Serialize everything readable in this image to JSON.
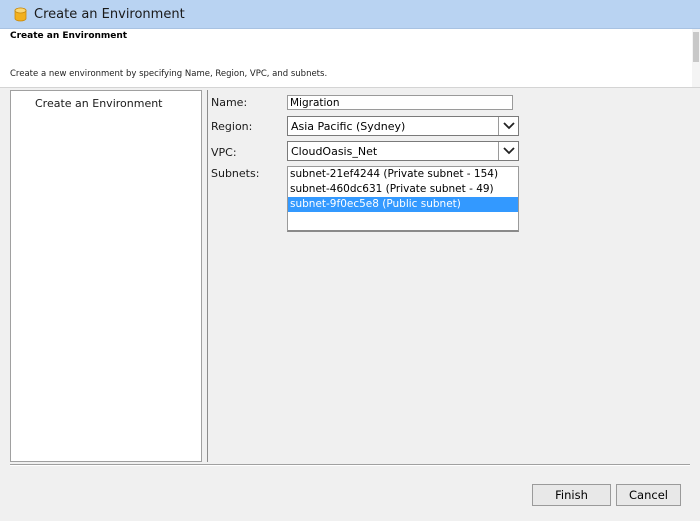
{
  "window": {
    "title": "Create an Environment"
  },
  "header": {
    "title": "Create an Environment",
    "description": "Create a new environment by specifying Name, Region, VPC, and subnets."
  },
  "nav": {
    "items": [
      {
        "label": "Create an Environment"
      }
    ]
  },
  "form": {
    "name_label": "Name:",
    "name_value": "Migration",
    "region_label": "Region:",
    "region_value": "Asia Pacific (Sydney)",
    "vpc_label": "VPC:",
    "vpc_value": "CloudOasis_Net",
    "subnets_label": "Subnets:",
    "subnets": [
      {
        "label": "subnet-21ef4244 (Private subnet - 154)",
        "selected": false
      },
      {
        "label": "subnet-460dc631 (Private subnet - 49)",
        "selected": false
      },
      {
        "label": "subnet-9f0ec5e8 (Public subnet)",
        "selected": true
      }
    ]
  },
  "footer": {
    "finish_label": "Finish",
    "cancel_label": "Cancel"
  },
  "colors": {
    "titlebar": "#b9d3f2",
    "selection": "#3399ff",
    "icon": "#f2b01e"
  },
  "icons": {
    "app": "database-cylinder-icon",
    "dropdown": "chevron-down-icon"
  }
}
